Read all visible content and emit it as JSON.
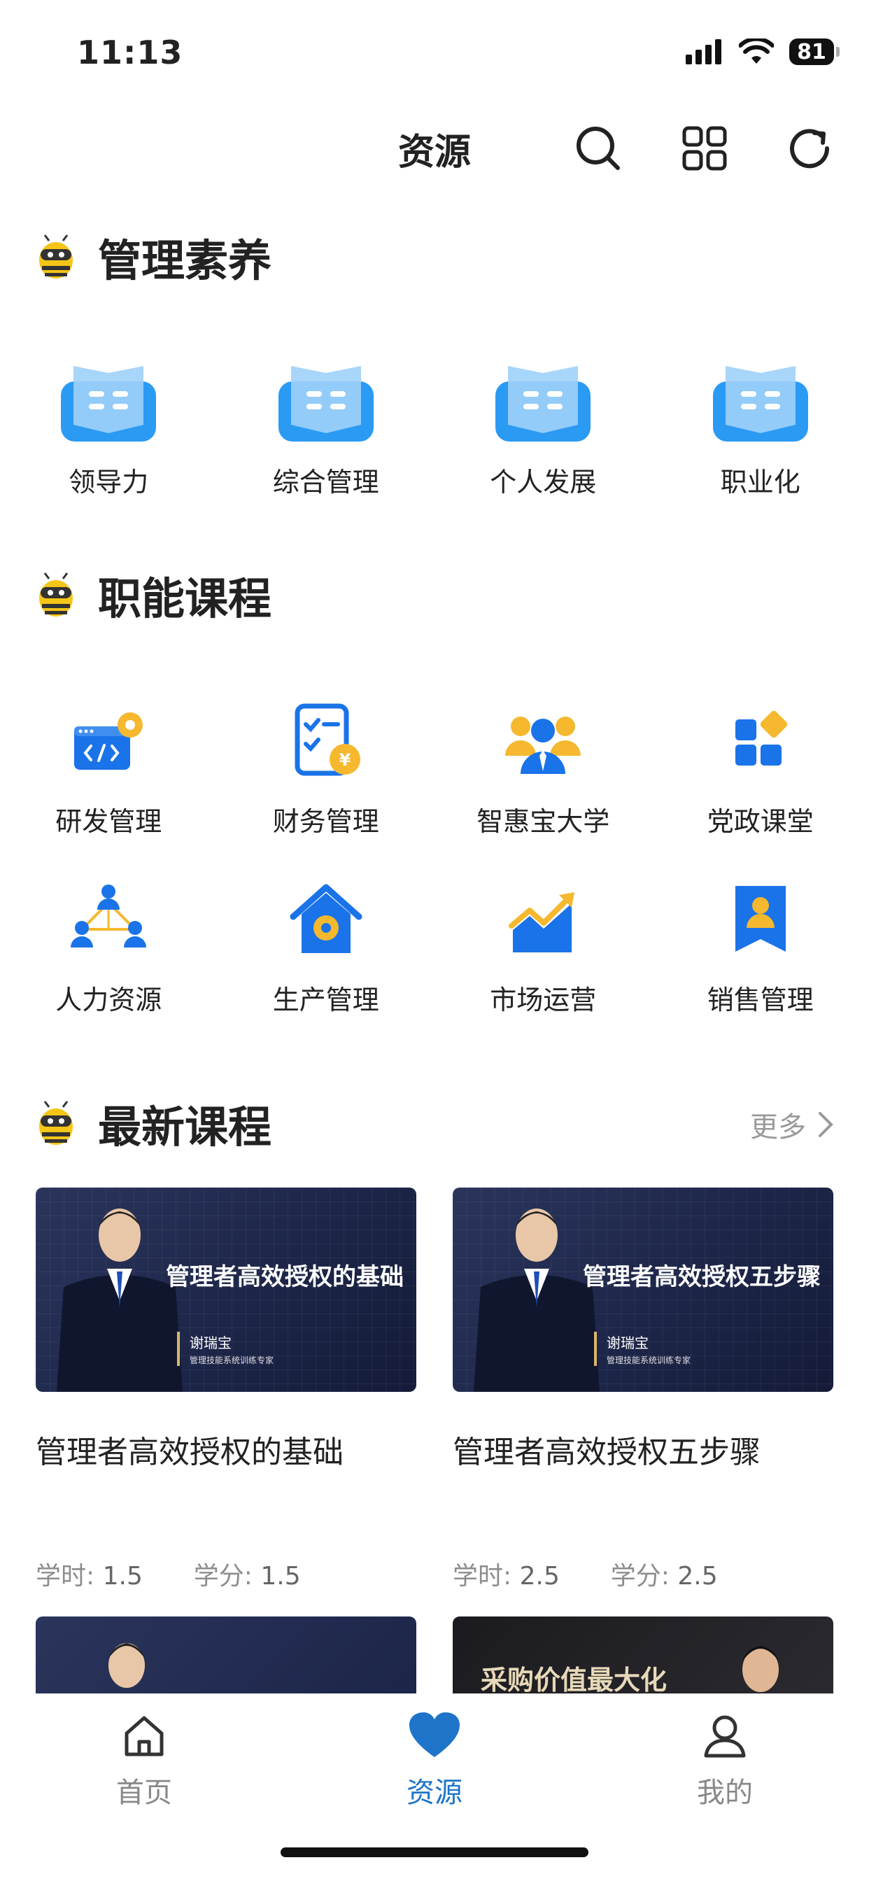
{
  "status_bar": {
    "time": "11:13",
    "battery": "81"
  },
  "header": {
    "title": "资源",
    "icons": [
      "search-icon",
      "grid-icon",
      "refresh-icon"
    ]
  },
  "section_management": {
    "title": "管理素养",
    "items": [
      {
        "label": "领导力",
        "icon": "book-icon"
      },
      {
        "label": "综合管理",
        "icon": "book-icon"
      },
      {
        "label": "个人发展",
        "icon": "book-icon"
      },
      {
        "label": "职业化",
        "icon": "book-icon"
      }
    ]
  },
  "section_functional": {
    "title": "职能课程",
    "items": [
      {
        "label": "研发管理",
        "icon": "code-settings-icon"
      },
      {
        "label": "财务管理",
        "icon": "finance-checklist-icon"
      },
      {
        "label": "智惠宝大学",
        "icon": "team-icon"
      },
      {
        "label": "党政课堂",
        "icon": "blocks-icon"
      },
      {
        "label": "人力资源",
        "icon": "network-people-icon"
      },
      {
        "label": "生产管理",
        "icon": "factory-house-icon"
      },
      {
        "label": "市场运营",
        "icon": "chart-growth-icon"
      },
      {
        "label": "销售管理",
        "icon": "person-badge-icon"
      }
    ]
  },
  "section_latest": {
    "title": "最新课程",
    "more": "更多",
    "courses": [
      {
        "thumb_title": "管理者高效授权的基础",
        "teacher": "谢瑞宝",
        "teacher_desc": "管理技能系统训练专家",
        "title": "管理者高效授权的基础",
        "hours_label": "学时:",
        "hours": "1.5",
        "credits_label": "学分:",
        "credits": "1.5"
      },
      {
        "thumb_title": "管理者高效授权五步骤",
        "teacher": "谢瑞宝",
        "teacher_desc": "管理技能系统训练专家",
        "title": "管理者高效授权五步骤",
        "hours_label": "学时:",
        "hours": "2.5",
        "credits_label": "学分:",
        "credits": "2.5"
      }
    ],
    "partial_title": "采购价值最大化"
  },
  "tabbar": {
    "tabs": [
      {
        "label": "首页",
        "icon": "home-icon"
      },
      {
        "label": "资源",
        "icon": "heart-icon",
        "active": true
      },
      {
        "label": "我的",
        "icon": "user-icon"
      }
    ]
  },
  "colors": {
    "accent": "#1e74c8",
    "icon_blue": "#1a73e8",
    "icon_yellow": "#f5b82e"
  }
}
